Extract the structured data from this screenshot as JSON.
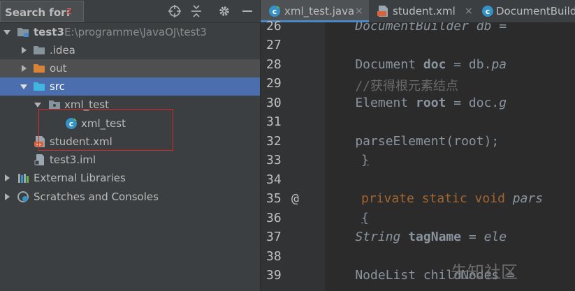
{
  "project_panel": {
    "search_label": "Search for:",
    "search_value": "z",
    "toolbar_icons": [
      "crosshair-icon",
      "collapse-icon",
      "gear-icon",
      "minimize-icon"
    ],
    "tree": [
      {
        "label": "test3",
        "path": "E:\\programme\\JavaOJ\\test3",
        "icon": "module-folder-icon",
        "expanded": true
      },
      {
        "label": ".idea",
        "icon": "folder-icon",
        "expanded": false
      },
      {
        "label": "out",
        "icon": "folder-orange-icon",
        "expanded": false
      },
      {
        "label": "src",
        "icon": "folder-blue-icon",
        "expanded": true,
        "selected": true
      },
      {
        "label": "xml_test",
        "icon": "package-icon",
        "expanded": true
      },
      {
        "label": "xml_test",
        "icon": "java-class-icon"
      },
      {
        "label": "student.xml",
        "icon": "xml-file-icon"
      },
      {
        "label": "test3.iml",
        "icon": "iml-file-icon"
      },
      {
        "label": "External Libraries",
        "icon": "libraries-icon",
        "expanded": false
      },
      {
        "label": "Scratches and Consoles",
        "icon": "scratches-icon",
        "expanded": false
      }
    ]
  },
  "editor": {
    "tabs": [
      {
        "label": "xml_test.java",
        "icon": "java-class-icon",
        "active": true,
        "close": "×"
      },
      {
        "label": "student.xml",
        "icon": "xml-file-icon",
        "active": false,
        "close": "×"
      },
      {
        "label": "DocumentBuild",
        "icon": "java-class-icon",
        "active": false
      }
    ],
    "line_numbers": [
      "26",
      "27",
      "28",
      "29",
      "30",
      "31",
      "32",
      "33",
      "34",
      "35",
      "36",
      "37",
      "38",
      "39"
    ],
    "gutter_mark": "@",
    "code": {
      "l26a": "    DocumentBuilder db = ",
      "l28a": "    Document ",
      "l28b": "doc",
      "l28c": " = db.",
      "l28d": "pa",
      "l29": "    //获得根元素结点",
      "l30a": "    Element ",
      "l30b": "root",
      "l30c": " = doc.",
      "l30d": "g",
      "l32a": "    parseElement(",
      "l32b": "root",
      "l32c": ");",
      "l33": "}",
      "l35a": "private static void ",
      "l35b": "pars",
      "l36": "{",
      "l37a": "    String ",
      "l37b": "tagName",
      "l37c": " = ",
      "l37d": "ele",
      "l39": "    NodeList childNodes ="
    },
    "watermark": "先知社区"
  }
}
